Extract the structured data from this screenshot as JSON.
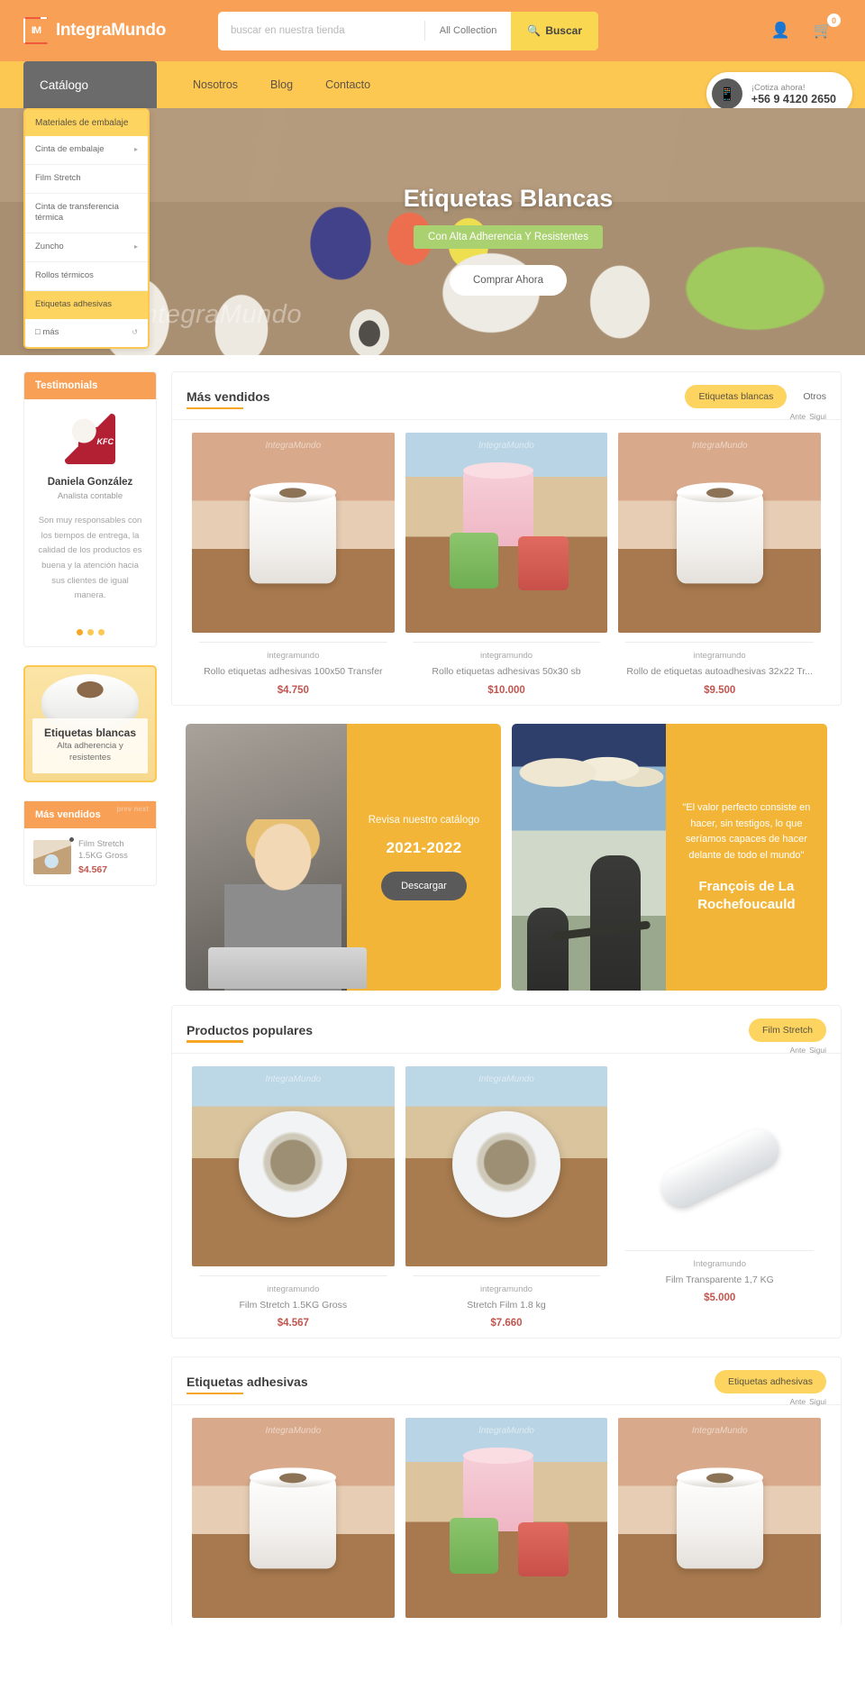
{
  "header": {
    "logo_text": "IntegraMundo",
    "logo_mark": "IM",
    "search_placeholder": "buscar en nuestra tienda",
    "search_value": "",
    "collection_label": "All Collection",
    "search_button": "Buscar",
    "search_icon": "search-icon",
    "user_icon": "user-icon",
    "cart_icon": "cart-icon",
    "cart_count": "0"
  },
  "nav": {
    "catalog_label": "Catálogo",
    "links": [
      {
        "label": "Nosotros"
      },
      {
        "label": "Blog"
      },
      {
        "label": "Contacto"
      }
    ],
    "quote": {
      "icon": "phone-icon",
      "line1": "¡Cotiza ahora!",
      "line2": "+56 9 4120 2650"
    }
  },
  "sidemenu": {
    "header": "Materiales de embalaje",
    "items": [
      {
        "label": "Cinta de embalaje",
        "has_caret": true
      },
      {
        "label": "Film Stretch",
        "has_caret": false
      },
      {
        "label": "Cinta de transferencia térmica",
        "has_caret": false
      },
      {
        "label": "Zuncho",
        "has_caret": true
      },
      {
        "label": "Rollos térmicos",
        "has_caret": false
      }
    ],
    "active_item": "Etiquetas adhesivas",
    "more_label": "más",
    "more_icon": "plus-icon",
    "more_caret": "chevron-down-icon"
  },
  "hero": {
    "title": "Etiquetas Blancas",
    "subtitle": "Con Alta Adherencia Y Resistentes",
    "cta": "Comprar Ahora",
    "watermark": "IntegraMundo"
  },
  "sidebar": {
    "testimonials": {
      "header": "Testimonials",
      "avatar": "kfc-logo",
      "avatar_label": "KFC",
      "name": "Daniela González",
      "role": "Analista contable",
      "text": "Son muy responsables con los tiempos de entrega, la calidad de los productos es buena y la atención hacia sus clientes de igual manera."
    },
    "promo": {
      "title": "Etiquetas blancas",
      "subtitle": "Alta adherencia y resistentes"
    },
    "best_sellers": {
      "header": "Más vendidos",
      "prev": "prev",
      "next": "next",
      "items": [
        {
          "title": "Film Stretch 1.5KG Gross",
          "price": "$4.567"
        }
      ]
    }
  },
  "sections": [
    {
      "title": "Más vendidos",
      "tabs": [
        {
          "label": "Etiquetas blancas",
          "active": true
        },
        {
          "label": "Otros",
          "active": false
        }
      ],
      "carousel": {
        "prev": "Ante",
        "next": "Sigui"
      },
      "products": [
        {
          "vendor": "integramundo",
          "name": "Rollo etiquetas adhesivas 100x50 Transfer",
          "price": "$4.750",
          "img": "white-roll"
        },
        {
          "vendor": "integramundo",
          "name": "Rollo etiquetas adhesivas 50x30 sb",
          "price": "$10.000",
          "img": "color-rolls"
        },
        {
          "vendor": "integramundo",
          "name": "Rollo de etiquetas autoadhesivas 32x22 Tr...",
          "price": "$9.500",
          "img": "white-roll"
        }
      ]
    },
    {
      "title": "Productos populares",
      "tabs": [
        {
          "label": "Film Stretch",
          "active": true
        }
      ],
      "carousel": {
        "prev": "Ante",
        "next": "Sigui"
      },
      "products": [
        {
          "vendor": "integramundo",
          "name": "Film Stretch 1.5KG Gross",
          "price": "$4.567",
          "img": "film-roll"
        },
        {
          "vendor": "integramundo",
          "name": "Stretch Film 1.8 kg",
          "price": "$7.660",
          "img": "film-roll"
        },
        {
          "vendor": "Integramundo",
          "name": "Film Transparente 1,7 KG",
          "price": "$5.000",
          "img": "film-horizontal"
        }
      ]
    },
    {
      "title": "Etiquetas adhesivas",
      "tabs": [
        {
          "label": "Etiquetas adhesivas",
          "active": true
        }
      ],
      "carousel": {
        "prev": "Ante",
        "next": "Sigui"
      },
      "products": [
        {
          "vendor": "",
          "name": "",
          "price": "",
          "img": "white-roll"
        },
        {
          "vendor": "",
          "name": "",
          "price": "",
          "img": "color-rolls"
        },
        {
          "vendor": "",
          "name": "",
          "price": "",
          "img": "white-roll"
        }
      ]
    }
  ],
  "banners": {
    "catalog": {
      "line1": "Revisa nuestro catálogo",
      "years": "2021-2022",
      "button": "Descargar"
    },
    "quote": {
      "text": "\"El valor perfecto consiste en hacer, sin testigos, lo que seríamos capaces de hacer delante de todo el mundo\"",
      "author": "François de La Rochefoucauld"
    }
  }
}
